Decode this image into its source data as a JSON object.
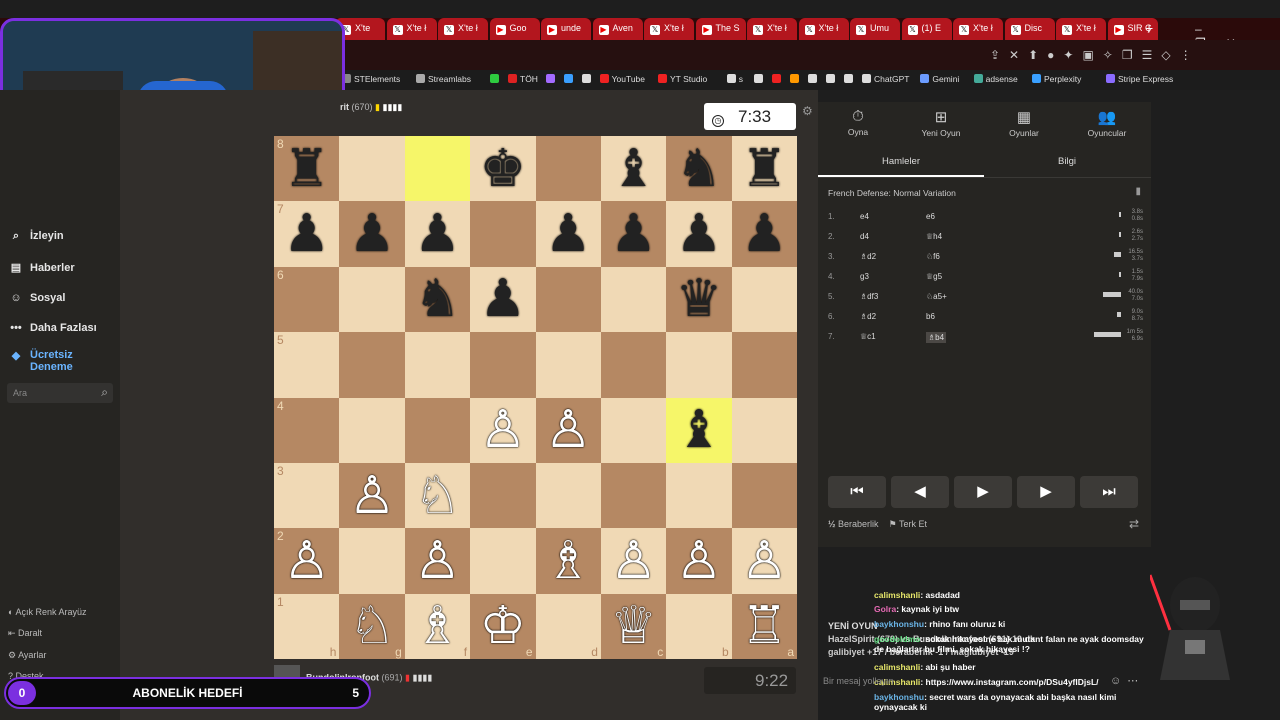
{
  "browser": {
    "tabs": [
      {
        "label": "X'te",
        "icon": "x-icon"
      },
      {
        "label": "X'te ł",
        "icon": "x-icon"
      },
      {
        "label": "X'te ł",
        "icon": "x-icon"
      },
      {
        "label": "Goo",
        "icon": "youtube-icon"
      },
      {
        "label": "unde",
        "icon": "youtube-icon"
      },
      {
        "label": "Aven",
        "icon": "youtube-icon"
      },
      {
        "label": "X'te ł",
        "icon": "x-icon"
      },
      {
        "label": "The S",
        "icon": "youtube-icon"
      },
      {
        "label": "X'te ł",
        "icon": "x-icon"
      },
      {
        "label": "X'te ł",
        "icon": "x-icon"
      },
      {
        "label": "Umu",
        "icon": "x-icon"
      },
      {
        "label": "(1) E",
        "icon": "x-icon"
      },
      {
        "label": "X'te ł",
        "icon": "x-icon"
      },
      {
        "label": "Disc",
        "icon": "x-icon"
      },
      {
        "label": "X'te ł",
        "icon": "x-icon"
      },
      {
        "label": "SIR Ç",
        "icon": "youtube-icon"
      }
    ],
    "bookmarks": [
      "STElements",
      "Streamlabs",
      "",
      "TÖH",
      "",
      "",
      "",
      "YouTube",
      "YT Studio",
      "s",
      "",
      "",
      "",
      "",
      "",
      "",
      "ChatGPT",
      "Gemini",
      "adsense",
      "Perplexity",
      "Stripe Express"
    ]
  },
  "sidebar": {
    "items": [
      {
        "label": "İzleyin",
        "icon": "binoculars-icon"
      },
      {
        "label": "Haberler",
        "icon": "news-icon"
      },
      {
        "label": "Sosyal",
        "icon": "social-icon"
      },
      {
        "label": "Daha Fazlası",
        "icon": "more-icon"
      },
      {
        "label": "Ücretsiz Deneme",
        "icon": "diamond-icon"
      }
    ],
    "search_placeholder": "Ara",
    "footer": [
      "Açık Renk Arayüz",
      "Daralt",
      "Ayarlar",
      "Destek"
    ]
  },
  "opponent": {
    "name": "rit",
    "rating": "(670)"
  },
  "player": {
    "name": "BundolinIronfoot",
    "rating": "(691)"
  },
  "clock_top": "7:33",
  "clock_bottom": "9:22",
  "board": {
    "ranks": [
      [
        "♜",
        "",
        "",
        "♚",
        "",
        "♝",
        "♞",
        "♜"
      ],
      [
        "♟",
        "♟",
        "♟",
        "",
        "♟",
        "♟",
        "♟",
        "♟"
      ],
      [
        "",
        "",
        "♞",
        "♟",
        "",
        "",
        "♛",
        ""
      ],
      [
        "",
        "",
        "",
        "",
        "",
        "",
        "",
        ""
      ],
      [
        "",
        "",
        "",
        "♙",
        "♙",
        "",
        "♝",
        ""
      ],
      [
        "",
        "♙",
        "♘",
        "",
        "",
        "",
        "",
        ""
      ],
      [
        "♙",
        "",
        "♙",
        "",
        "♗",
        "♙",
        "♙",
        "♙"
      ],
      [
        "",
        "♘",
        "♗",
        "♔",
        "",
        "♕",
        "",
        "♖"
      ]
    ],
    "rank_labels": [
      "8",
      "7",
      "6",
      "5",
      "4",
      "3",
      "2",
      "1"
    ],
    "file_labels": [
      "h",
      "g",
      "f",
      "e",
      "d",
      "c",
      "b",
      "a"
    ],
    "highlights": [
      [
        0,
        2
      ],
      [
        4,
        6
      ]
    ]
  },
  "panel": {
    "tabs": [
      {
        "label": "Oyna",
        "icon": "stopwatch-icon"
      },
      {
        "label": "Yeni Oyun",
        "icon": "plus-icon"
      },
      {
        "label": "Oyunlar",
        "icon": "board-icon"
      },
      {
        "label": "Oyuncular",
        "icon": "players-icon"
      }
    ],
    "subtabs": [
      "Hamleler",
      "Bilgi"
    ],
    "opening": "French Defense: Normal Variation",
    "moves": [
      {
        "n": "1.",
        "w": "e4",
        "b": "e6",
        "t1": "3.8s",
        "t2": "0.8s",
        "bar": 0.05
      },
      {
        "n": "2.",
        "w": "d4",
        "b": "♕h4",
        "t1": "2.6s",
        "t2": "2.7s",
        "bar": 0.04
      },
      {
        "n": "3.",
        "w": "♗d2",
        "b": "♘f6",
        "t1": "16.5s",
        "t2": "3.7s",
        "bar": 0.15
      },
      {
        "n": "4.",
        "w": "g3",
        "b": "♕g5",
        "t1": "1.5s",
        "t2": "7.9s",
        "bar": 0.05
      },
      {
        "n": "5.",
        "w": "♗df3",
        "b": "♘a5+",
        "t1": "40.0s",
        "t2": "7.0s",
        "bar": 0.4
      },
      {
        "n": "6.",
        "w": "♗d2",
        "b": "b6",
        "t1": "9.0s",
        "t2": "8.7s",
        "bar": 0.08
      },
      {
        "n": "7.",
        "w": "♕c1",
        "b": "♗b4",
        "t1": "1m 5s",
        "t2": "6.9s",
        "bar": 0.6
      }
    ],
    "nav": [
      "⏮",
      "◀",
      "▶",
      "▶",
      "⏭"
    ],
    "draw_label": "Beraberlik",
    "resign_label": "Terk Et"
  },
  "chat": {
    "new_game": [
      "YENİ OYUN",
      "HazelSpirit (679) vs BundolinIronfoot (691) 10 dk",
      "galibiyet +17 / beraberlik -1 / mağlubiyet -19"
    ],
    "lines": [
      {
        "user": "calimshanli",
        "text": ": asdadad"
      },
      {
        "user": "Golra",
        "text": ": kaynak iyi btw"
      },
      {
        "user": "baykhonshu",
        "text": ": rhino fanı oluruz ki"
      },
      {
        "user": "goodoldmo",
        "text": ": sokak hikayesine bak mutant falan ne ayak doomsday de bağlarlar bu filmi, sokak hikayesi !?"
      },
      {
        "user": "calimshanli",
        "text": ": abi şu haber"
      },
      {
        "user": "calimshanli",
        "text": ": https://www.instagram.com/p/DSu4yflDjsL/"
      },
      {
        "user": "baykhonshu",
        "text": ": secret wars da oynayacak abi başka nasıl kimi oynayacak ki"
      }
    ],
    "input_placeholder": "Bir mesaj yollayın"
  },
  "goal": {
    "start": "0",
    "title": "ABONELİK HEDEFİ",
    "target": "5"
  }
}
